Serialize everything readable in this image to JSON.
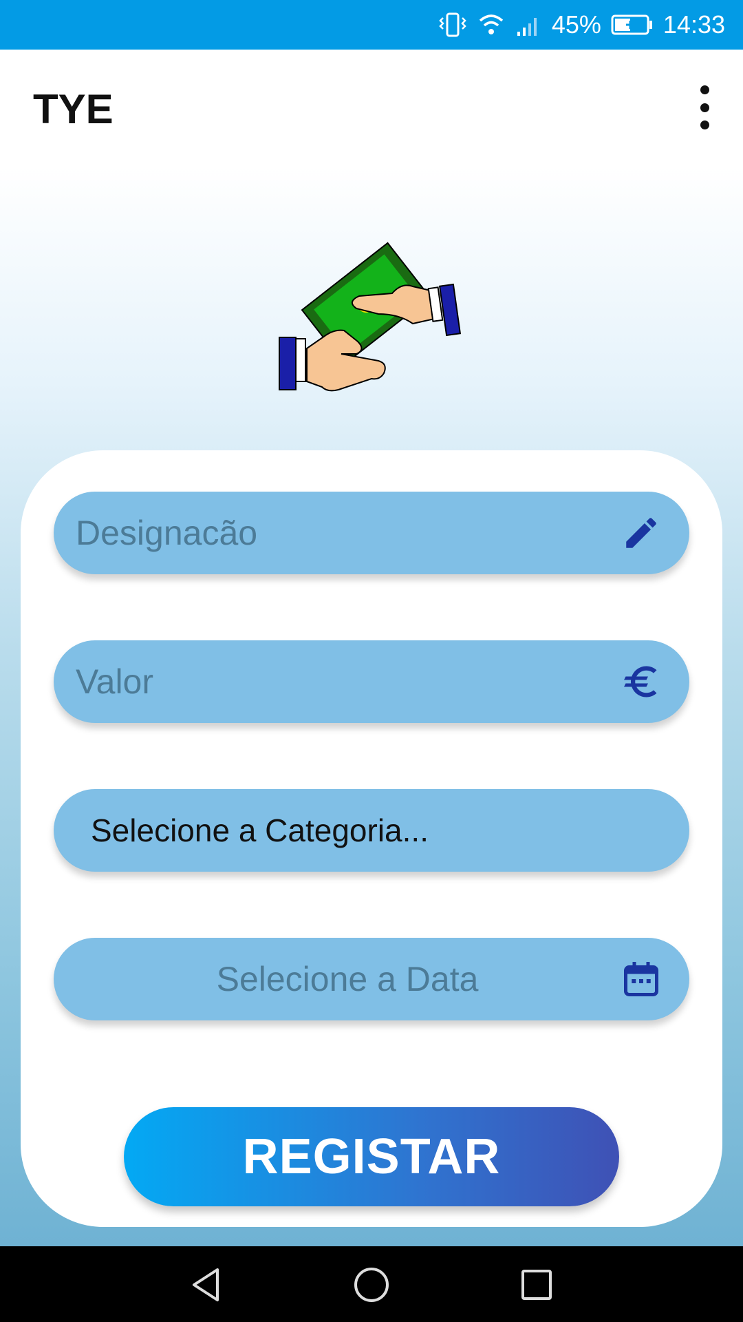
{
  "status_bar": {
    "battery_percent": "45%",
    "time": "14:33",
    "icons": [
      "vibrate-icon",
      "wifi-icon",
      "signal-icon",
      "battery-charging-icon"
    ]
  },
  "app_bar": {
    "title": "TYE",
    "overflow_icon": "more-vert-icon"
  },
  "logo": {
    "icon": "money-exchange-hands-icon"
  },
  "form": {
    "designation": {
      "placeholder": "Designacão",
      "icon": "pencil-icon"
    },
    "value": {
      "placeholder": "Valor",
      "icon": "euro-icon"
    },
    "category": {
      "selected": "Selecione a Categoria..."
    },
    "date": {
      "placeholder": "Selecione a Data",
      "icon": "calendar-icon"
    },
    "submit_label": "REGISTAR"
  },
  "colors": {
    "status_bar": "#039be5",
    "field_bg": "#80bfe6",
    "icon_accent": "#1a35a0",
    "button_start": "#03a9f4",
    "button_end": "#3f51b5"
  },
  "nav_bar": {
    "icons": [
      "back-icon",
      "home-icon",
      "recents-icon"
    ]
  }
}
